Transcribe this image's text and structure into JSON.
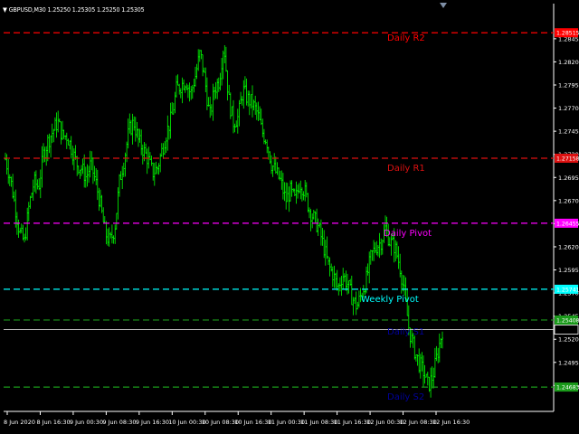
{
  "header": {
    "symbol_text": "GBPUSD,M30  1.25250 1.25305 1.25250 1.25305"
  },
  "colors": {
    "background": "#000000",
    "axis": "#ffffff",
    "grid": "#555555",
    "bars": "#00ff00",
    "r2": "#ff0000",
    "r1": "#dd1111",
    "pivot": "#ff00ff",
    "weekly_pivot": "#00ffff",
    "support": "#1a9a1a",
    "support_label": "#000099",
    "current_price_line": "#c0c0c0"
  },
  "chart_data": {
    "type": "ohlc",
    "symbol": "GBPUSD",
    "timeframe": "M30",
    "ylim": [
      1.2442,
      1.2883
    ],
    "y_ticks": [
      1.2845,
      1.282,
      1.2795,
      1.277,
      1.2745,
      1.272,
      1.2695,
      1.267,
      1.2645,
      1.262,
      1.2595,
      1.257,
      1.2545,
      1.252,
      1.2495,
      1.247
    ],
    "x_ticks": [
      "8 Jun 2020",
      "8 Jun 16:30",
      "9 Jun 00:30",
      "9 Jun 08:30",
      "9 Jun 16:30",
      "10 Jun 00:30",
      "10 Jun 08:30",
      "10 Jun 16:30",
      "11 Jun 00:30",
      "11 Jun 08:30",
      "11 Jun 16:30",
      "12 Jun 00:30",
      "12 Jun 08:30",
      "12 Jun 16:30"
    ],
    "levels": [
      {
        "name": "Daily R2",
        "value": 1.28515,
        "label_value": "1.28515",
        "color": "r2",
        "label_color": "r2",
        "style": "dash"
      },
      {
        "name": "Daily R1",
        "value": 1.27158,
        "label_value": "1.27158",
        "color": "r1",
        "label_color": "r1",
        "style": "dash"
      },
      {
        "name": "Daily Pivot",
        "value": 1.26455,
        "label_value": "1.26455",
        "color": "pivot",
        "label_color": "pivot",
        "style": "dash"
      },
      {
        "name": "Weekly Pivot",
        "value": 1.25741,
        "label_value": "1.25741",
        "color": "weekly_pivot",
        "label_color": "weekly_pivot",
        "style": "dash"
      },
      {
        "name": "Daily S1",
        "value": 1.25408,
        "label_value": "1.25408",
        "color": "support",
        "label_color": "support_label",
        "style": "dash"
      },
      {
        "name": "Daily S2",
        "value": 1.24683,
        "label_value": "1.24683",
        "color": "support",
        "label_color": "support_label",
        "style": "dash"
      }
    ],
    "current_price": 1.25305,
    "price_path": [
      1.2715,
      1.2695,
      1.2665,
      1.2635,
      1.2625,
      1.2665,
      1.269,
      1.2685,
      1.272,
      1.2735,
      1.2745,
      1.2755,
      1.274,
      1.274,
      1.2725,
      1.271,
      1.2705,
      1.2695,
      1.271,
      1.269,
      1.2665,
      1.2635,
      1.2625,
      1.264,
      1.269,
      1.2715,
      1.2745,
      1.2755,
      1.2735,
      1.2725,
      1.2715,
      1.27,
      1.2705,
      1.2725,
      1.2745,
      1.276,
      1.279,
      1.2795,
      1.28,
      1.2785,
      1.2805,
      1.283,
      1.28,
      1.276,
      1.279,
      1.28,
      1.284,
      1.278,
      1.2755,
      1.276,
      1.279,
      1.278,
      1.2775,
      1.2765,
      1.2745,
      1.2735,
      1.271,
      1.27,
      1.269,
      1.267,
      1.268,
      1.267,
      1.269,
      1.268,
      1.266,
      1.265,
      1.264,
      1.262,
      1.26,
      1.259,
      1.2575,
      1.259,
      1.258,
      1.2565,
      1.2555,
      1.257,
      1.2585,
      1.261,
      1.262,
      1.2625,
      1.264,
      1.2625,
      1.262,
      1.26,
      1.257,
      1.253,
      1.251,
      1.2495,
      1.2485,
      1.247,
      1.248,
      1.2505,
      1.253
    ]
  }
}
